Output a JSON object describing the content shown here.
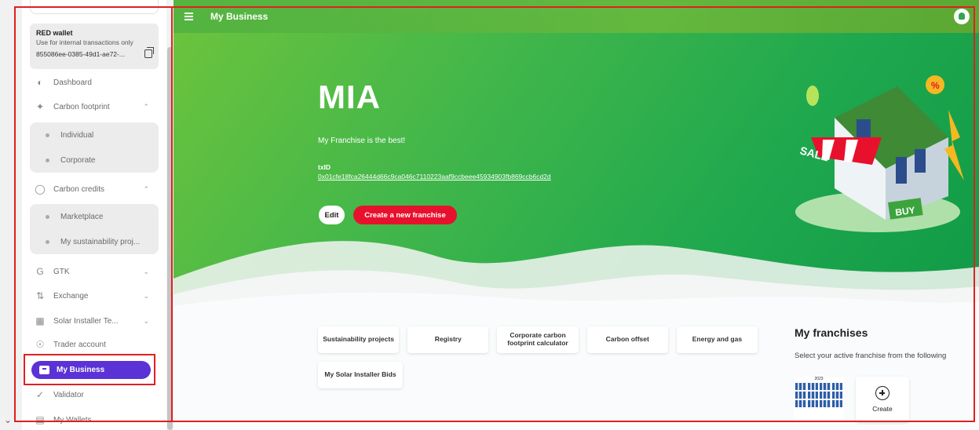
{
  "colors": {
    "accent": "#5b32d6",
    "brand_red": "#e8112d",
    "hero_green": "#2fa84f",
    "highlight": "#e02020"
  },
  "wallet": {
    "title": "RED wallet",
    "subtitle": "Use for internal transactions only",
    "address": "855086ee-0385-49d1-ae72-..."
  },
  "sidebar": {
    "items": [
      {
        "label": "Dashboard",
        "icon": "dashboard-icon"
      },
      {
        "label": "Carbon footprint",
        "icon": "footprint-icon",
        "arrow": "^"
      },
      {
        "label": "Carbon credits",
        "icon": "credits-icon",
        "arrow": "^"
      },
      {
        "label": "GTK",
        "icon": "gtk-icon",
        "arrow": "v"
      },
      {
        "label": "Exchange",
        "icon": "exchange-icon",
        "arrow": "v"
      },
      {
        "label": "Solar Installer Te...",
        "icon": "solar-icon",
        "arrow": "v"
      },
      {
        "label": "Trader account",
        "icon": "trader-icon"
      },
      {
        "label": "My Business",
        "icon": "briefcase-icon"
      },
      {
        "label": "Validator",
        "icon": "check-icon"
      },
      {
        "label": "My Wallets",
        "icon": "wallet-icon"
      }
    ],
    "carbon_footprint_sub": [
      "Individual",
      "Corporate"
    ],
    "carbon_credits_sub": [
      "Marketplace",
      "My sustainability proj..."
    ]
  },
  "header": {
    "title": "My Business"
  },
  "hero": {
    "name": "MIA",
    "tagline": "My Franchise is the best!",
    "txid_label": "txID",
    "txid": "0x01cfe18fca26444d66c9ca046c7110223aaf9ccbeee45934903fb869ccb6cd2d",
    "edit_label": "Edit",
    "create_label": "Create a new franchise"
  },
  "illustration": {
    "sale": "SALE",
    "buy": "BUY",
    "badge": "%"
  },
  "cards": [
    "Sustainability projects",
    "Registry",
    "Corporate carbon footprint calculator",
    "Carbon offset",
    "Energy and gas",
    "My Solar Installer Bids"
  ],
  "franchises": {
    "heading": "My franchises",
    "description": "Select your active franchise from the following",
    "create_label": "Create",
    "thumb_year": "2023"
  }
}
